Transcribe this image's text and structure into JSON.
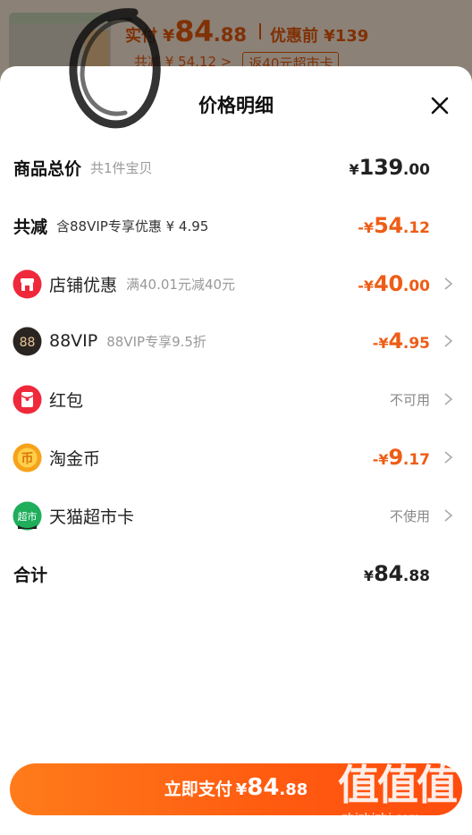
{
  "background": {
    "price_label": "实付",
    "price_yen": "¥",
    "price_int": "84",
    "price_dec": ".88",
    "original_price": "优惠前 ¥139",
    "saved": "共减 ¥ 54.12 >",
    "return_tag": "返40元超市卡"
  },
  "sheet": {
    "title": "价格明细",
    "close_icon": "close-icon"
  },
  "rows": {
    "total": {
      "label": "商品总价",
      "sub": "共1件宝贝",
      "yen": "¥",
      "int": "139",
      "dec": ".00"
    },
    "reduce": {
      "label": "共减",
      "sub": "含88VIP专享优惠 ¥ 4.95",
      "yen": "-¥",
      "int": "54",
      "dec": ".12"
    },
    "shop": {
      "icon": "shop-icon",
      "label": "店铺优惠",
      "sub": "满40.01元减40元",
      "yen": "-¥",
      "int": "40",
      "dec": ".00"
    },
    "vip": {
      "icon": "vip-88-icon",
      "label": "88VIP",
      "sub": "88VIP专享9.5折",
      "yen": "-¥",
      "int": "4",
      "dec": ".95"
    },
    "redpacket": {
      "icon": "red-packet-icon",
      "label": "红包",
      "value": "不可用"
    },
    "coin": {
      "icon": "coin-icon",
      "label": "淘金币",
      "yen": "-¥",
      "int": "9",
      "dec": ".17"
    },
    "card": {
      "icon": "supermarket-card-icon",
      "label": "天猫超市卡",
      "value": "不使用"
    },
    "sum": {
      "label": "合计",
      "yen": "¥",
      "int": "84",
      "dec": ".88"
    }
  },
  "pay_button": {
    "label": "立即支付",
    "yen": "¥",
    "int": "84",
    "dec": ".88"
  },
  "watermark": {
    "glyphs": "值值值",
    "text": "zhizhizhi.com"
  },
  "icon_glyphs": {
    "vip": "88",
    "card": "超市",
    "coin": "币"
  },
  "colors": {
    "accent": "#ee5d16",
    "button": "#ff5a10"
  }
}
